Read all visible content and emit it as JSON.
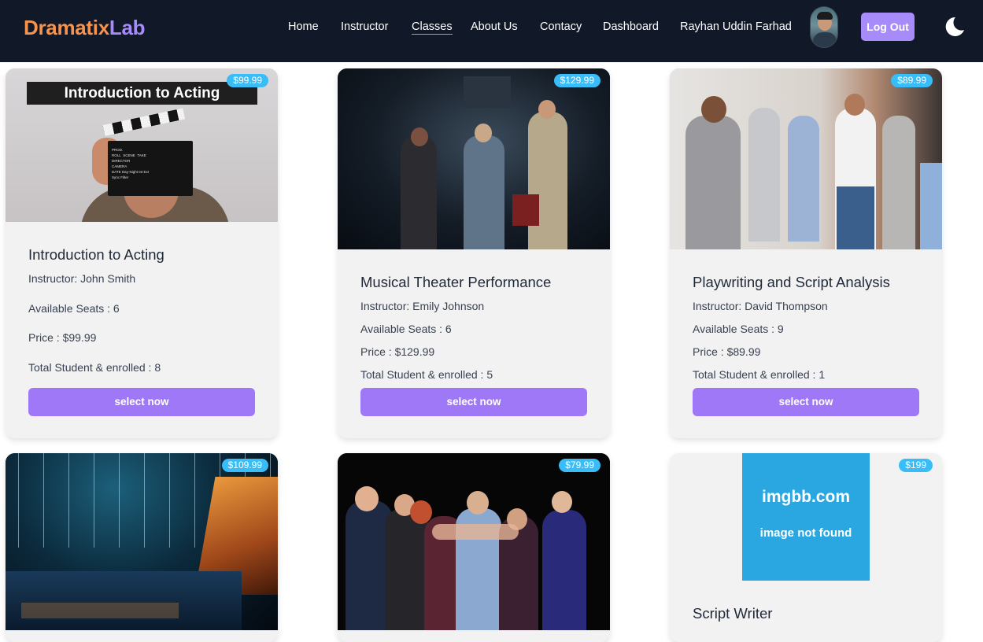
{
  "brand": {
    "part1": "Dramatix",
    "part2": "Lab"
  },
  "nav": {
    "items": [
      "Home",
      "Instructor",
      "Classes",
      "About Us",
      "Contacy",
      "Dashboard"
    ],
    "user_name": "Rayhan Uddin Farhad",
    "logout_label": "Log Out",
    "theme_icon": "moon-icon"
  },
  "labels": {
    "instructor_prefix": "Instructor: ",
    "seats_prefix": "Available Seats : ",
    "price_prefix": "Price : ",
    "enrolled_prefix": "Total Student & enrolled : ",
    "select_label": "select now"
  },
  "classes": [
    {
      "name": "Introduction to Acting",
      "badge": "$99.99",
      "image_caption": "Introduction to Acting",
      "clapper_lines": [
        "PROD.",
        "ROLL",
        "SCENE",
        "TAKE",
        "DIRECTOR",
        "CAMERA",
        "DATE",
        "Day-Night Int Ext",
        "Sync Filter"
      ],
      "instructor_line": "Instructor: John Smith",
      "seats_line": "Available Seats : 6",
      "price_line": "Price : $99.99",
      "enrolled_line": "Total Student & enrolled : 8",
      "select_label": "select now"
    },
    {
      "name": "Musical Theater Performance",
      "badge": "$129.99",
      "instructor_line": "Instructor: Emily Johnson",
      "seats_line": "Available Seats : 6",
      "price_line": "Price : $129.99",
      "enrolled_line": "Total Student & enrolled : 5",
      "select_label": "select now"
    },
    {
      "name": "Playwriting and Script Analysis",
      "badge": "$89.99",
      "instructor_line": "Instructor: David Thompson",
      "seats_line": "Available Seats : 9",
      "price_line": "Price : $89.99",
      "enrolled_line": "Total Student & enrolled : 1",
      "select_label": "select now"
    },
    {
      "name": "",
      "badge": "$109.99"
    },
    {
      "name": "",
      "badge": "$79.99"
    },
    {
      "name": "Script Writer",
      "badge": "$199",
      "placeholder_title": "imgbb.com",
      "placeholder_subtitle": "image not found"
    }
  ],
  "colors": {
    "nav_bg": "#111827",
    "accent": "#a78bfa",
    "badge": "#38bdf8",
    "button": "#9f78f7",
    "card_bg": "#f2f2f3"
  }
}
